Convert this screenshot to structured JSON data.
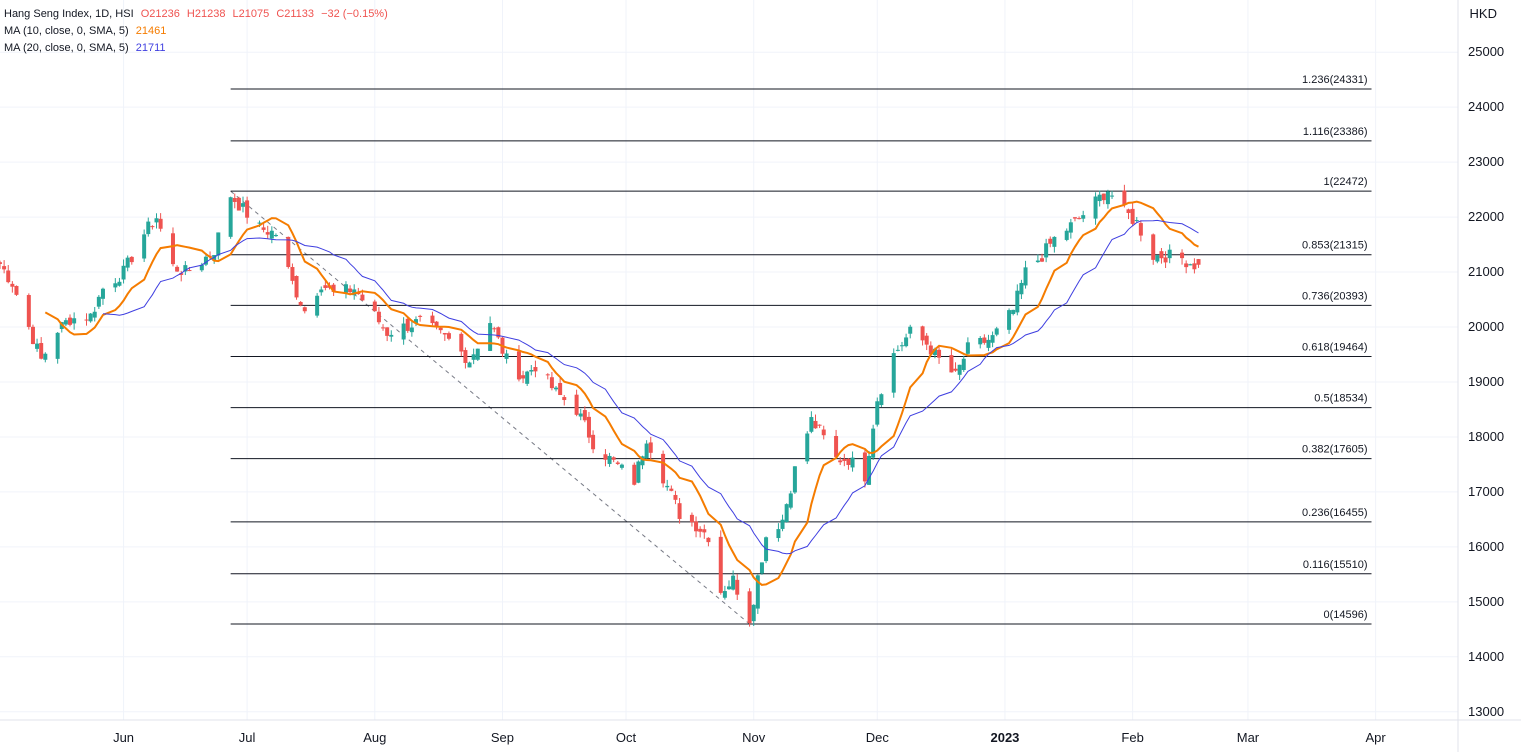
{
  "legend": {
    "title": "Hang Seng Index, 1D, HSI",
    "open": "O21236",
    "high": "H21238",
    "low": "L21075",
    "close": "C21133",
    "change": "−32 (−0.15%)",
    "ma10_label": "MA (10, close, 0, SMA, 5)",
    "ma10_value": "21461",
    "ma20_label": "MA (20, close, 0, SMA, 5)",
    "ma20_value": "21711"
  },
  "currency": "HKD",
  "colors": {
    "up": "#26a69a",
    "down": "#ef5350",
    "ma10": "#f57c00",
    "ma20": "#3f3fe0",
    "fib": "#131722",
    "grid": "#f0f3fa",
    "text": "#131722"
  },
  "chart_data": {
    "type": "candlestick",
    "y_axis": {
      "ticks": [
        13000,
        14000,
        15000,
        16000,
        17000,
        18000,
        19000,
        20000,
        21000,
        22000,
        23000,
        24000,
        25000
      ],
      "range": [
        12850,
        25950
      ]
    },
    "x_axis": {
      "labels": [
        {
          "label": "Jun",
          "date": "2022-06-01"
        },
        {
          "label": "Jul",
          "date": "2022-07-01"
        },
        {
          "label": "Aug",
          "date": "2022-08-01"
        },
        {
          "label": "Sep",
          "date": "2022-09-01"
        },
        {
          "label": "Oct",
          "date": "2022-10-01"
        },
        {
          "label": "Nov",
          "date": "2022-11-01"
        },
        {
          "label": "Dec",
          "date": "2022-12-01"
        },
        {
          "label": "2023",
          "date": "2023-01-01",
          "bold": true
        },
        {
          "label": "Feb",
          "date": "2023-02-01"
        },
        {
          "label": "Mar",
          "date": "2023-03-01"
        },
        {
          "label": "Apr",
          "date": "2023-04-01"
        }
      ],
      "range": [
        "2022-05-02",
        "2023-04-21"
      ]
    },
    "fibonacci": {
      "from": {
        "date": "2022-06-27",
        "price": 22472
      },
      "to": {
        "date": "2022-10-31",
        "price": 14596
      },
      "end_date": "2023-03-31",
      "levels": [
        {
          "label": "1.236(24331)",
          "price": 24331
        },
        {
          "label": "1.116(23386)",
          "price": 23386
        },
        {
          "label": "1(22472)",
          "price": 22472
        },
        {
          "label": "0.853(21315)",
          "price": 21315
        },
        {
          "label": "0.736(20393)",
          "price": 20393
        },
        {
          "label": "0.618(19464)",
          "price": 19464
        },
        {
          "label": "0.5(18534)",
          "price": 18534
        },
        {
          "label": "0.382(17605)",
          "price": 17605
        },
        {
          "label": "0.236(16455)",
          "price": 16455
        },
        {
          "label": "0.116(15510)",
          "price": 15510
        },
        {
          "label": "0(14596)",
          "price": 14596
        }
      ]
    },
    "close_anchors": [
      [
        "2022-05-02",
        21150
      ],
      [
        "2022-05-05",
        20800
      ],
      [
        "2022-05-09",
        20000
      ],
      [
        "2022-05-12",
        19400
      ],
      [
        "2022-05-16",
        19950
      ],
      [
        "2022-05-19",
        20150
      ],
      [
        "2022-05-24",
        20200
      ],
      [
        "2022-05-27",
        20700
      ],
      [
        "2022-06-01",
        21000
      ],
      [
        "2022-06-06",
        21700
      ],
      [
        "2022-06-09",
        22000
      ],
      [
        "2022-06-13",
        21100
      ],
      [
        "2022-06-16",
        21000
      ],
      [
        "2022-06-20",
        21200
      ],
      [
        "2022-06-23",
        21400
      ],
      [
        "2022-06-27",
        22400
      ],
      [
        "2022-07-04",
        21800
      ],
      [
        "2022-07-08",
        21700
      ],
      [
        "2022-07-12",
        20800
      ],
      [
        "2022-07-15",
        20300
      ],
      [
        "2022-07-19",
        20800
      ],
      [
        "2022-07-22",
        20600
      ],
      [
        "2022-07-27",
        20700
      ],
      [
        "2022-08-01",
        20200
      ],
      [
        "2022-08-04",
        19900
      ],
      [
        "2022-08-08",
        20000
      ],
      [
        "2022-08-12",
        20100
      ],
      [
        "2022-08-16",
        19900
      ],
      [
        "2022-08-19",
        19750
      ],
      [
        "2022-08-24",
        19400
      ],
      [
        "2022-08-29",
        20100
      ],
      [
        "2022-09-02",
        19400
      ],
      [
        "2022-09-06",
        19100
      ],
      [
        "2022-09-09",
        19300
      ],
      [
        "2022-09-14",
        18800
      ],
      [
        "2022-09-19",
        18500
      ],
      [
        "2022-09-23",
        17900
      ],
      [
        "2022-09-27",
        17600
      ],
      [
        "2022-10-03",
        17200
      ],
      [
        "2022-10-06",
        18000
      ],
      [
        "2022-10-11",
        17100
      ],
      [
        "2022-10-14",
        16600
      ],
      [
        "2022-10-18",
        16400
      ],
      [
        "2022-10-21",
        16200
      ],
      [
        "2022-10-24",
        15200
      ],
      [
        "2022-10-27",
        15400
      ],
      [
        "2022-10-31",
        14700
      ],
      [
        "2022-11-04",
        16200
      ],
      [
        "2022-11-08",
        16500
      ],
      [
        "2022-11-11",
        17400
      ],
      [
        "2022-11-15",
        18300
      ],
      [
        "2022-11-17",
        18100
      ],
      [
        "2022-11-21",
        17600
      ],
      [
        "2022-11-24",
        17600
      ],
      [
        "2022-11-28",
        17300
      ],
      [
        "2022-12-01",
        18700
      ],
      [
        "2022-12-05",
        19500
      ],
      [
        "2022-12-09",
        19900
      ],
      [
        "2022-12-13",
        19700
      ],
      [
        "2022-12-16",
        19400
      ],
      [
        "2022-12-20",
        19100
      ],
      [
        "2022-12-23",
        19600
      ],
      [
        "2022-12-29",
        19800
      ],
      [
        "2023-01-03",
        20300
      ],
      [
        "2023-01-06",
        21000
      ],
      [
        "2023-01-10",
        21300
      ],
      [
        "2023-01-13",
        21600
      ],
      [
        "2023-01-18",
        21900
      ],
      [
        "2023-01-26",
        22500
      ],
      [
        "2023-01-30",
        22100
      ],
      [
        "2023-02-02",
        21900
      ],
      [
        "2023-02-06",
        21300
      ],
      [
        "2023-02-09",
        21300
      ],
      [
        "2023-02-13",
        21250
      ],
      [
        "2023-02-16",
        21133
      ]
    ],
    "last_bar": {
      "date": "2023-02-17",
      "open": 21236,
      "high": 21238,
      "low": 21075,
      "close": 21133
    },
    "series": [
      {
        "name": "MA (10, close, 0, SMA, 5)",
        "period": 10,
        "last": 21461
      },
      {
        "name": "MA (20, close, 0, SMA, 5)",
        "period": 20,
        "last": 21711
      }
    ]
  }
}
